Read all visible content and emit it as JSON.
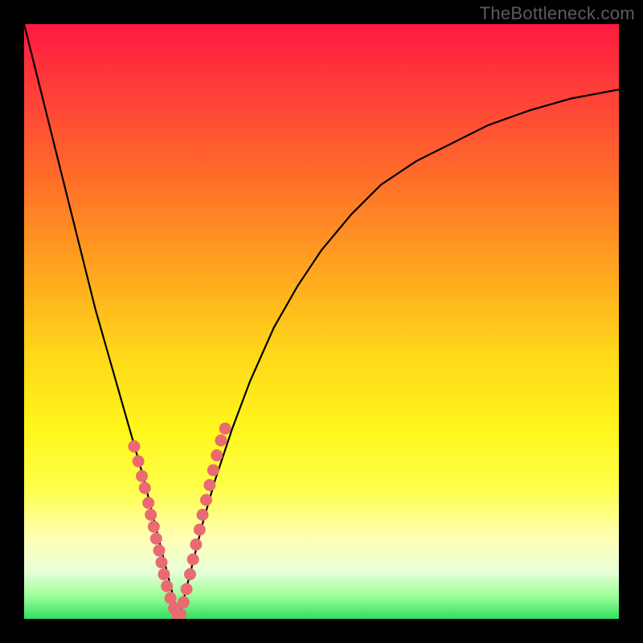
{
  "watermark": "TheBottleneck.com",
  "colors": {
    "background": "#000000",
    "gradient_top": "#ff1a40",
    "gradient_bottom": "#30e060",
    "curve": "#000000",
    "dots": "#ea6a72"
  },
  "chart_data": {
    "type": "line",
    "title": "",
    "xlabel": "",
    "ylabel": "",
    "xlim": [
      0,
      100
    ],
    "ylim": [
      0,
      100
    ],
    "series": [
      {
        "name": "left-curve",
        "x": [
          0,
          2,
          4,
          6,
          8,
          10,
          12,
          14,
          16,
          18,
          20,
          22,
          23,
          24,
          25,
          26
        ],
        "y": [
          100,
          92,
          84,
          76,
          68,
          60,
          52,
          45,
          38,
          31,
          24,
          16,
          12,
          8,
          4,
          0
        ]
      },
      {
        "name": "right-curve",
        "x": [
          26,
          28,
          30,
          32,
          35,
          38,
          42,
          46,
          50,
          55,
          60,
          66,
          72,
          78,
          85,
          92,
          100
        ],
        "y": [
          0,
          8,
          16,
          23,
          32,
          40,
          49,
          56,
          62,
          68,
          73,
          77,
          80,
          83,
          85.5,
          87.5,
          89
        ]
      }
    ],
    "scatter": [
      {
        "name": "left-dots",
        "x": [
          18.5,
          19.2,
          19.8,
          20.3,
          20.9,
          21.3,
          21.8,
          22.2,
          22.7,
          23.1,
          23.5,
          24.0,
          24.6,
          25.2,
          25.8
        ],
        "y": [
          29.0,
          26.5,
          24.0,
          22.0,
          19.5,
          17.5,
          15.5,
          13.5,
          11.5,
          9.5,
          7.5,
          5.5,
          3.5,
          1.8,
          0.5
        ]
      },
      {
        "name": "right-dots",
        "x": [
          26.3,
          26.8,
          27.3,
          27.9,
          28.4,
          28.9,
          29.5,
          30.0,
          30.6,
          31.2,
          31.8,
          32.4,
          33.1,
          33.8
        ],
        "y": [
          0.8,
          2.8,
          5.0,
          7.5,
          10.0,
          12.5,
          15.0,
          17.5,
          20.0,
          22.5,
          25.0,
          27.5,
          30.0,
          32.0
        ]
      }
    ],
    "gradient_stops": [
      {
        "offset": 0,
        "color": "#ff1a40"
      },
      {
        "offset": 10,
        "color": "#ff3a3a"
      },
      {
        "offset": 25,
        "color": "#ff6a2a"
      },
      {
        "offset": 40,
        "color": "#ffa020"
      },
      {
        "offset": 55,
        "color": "#ffd61a"
      },
      {
        "offset": 68,
        "color": "#fff61a"
      },
      {
        "offset": 78,
        "color": "#ffff4a"
      },
      {
        "offset": 86,
        "color": "#ffffb0"
      },
      {
        "offset": 92,
        "color": "#e8ffd8"
      },
      {
        "offset": 96,
        "color": "#a0ff9a"
      },
      {
        "offset": 100,
        "color": "#30e060"
      }
    ]
  }
}
